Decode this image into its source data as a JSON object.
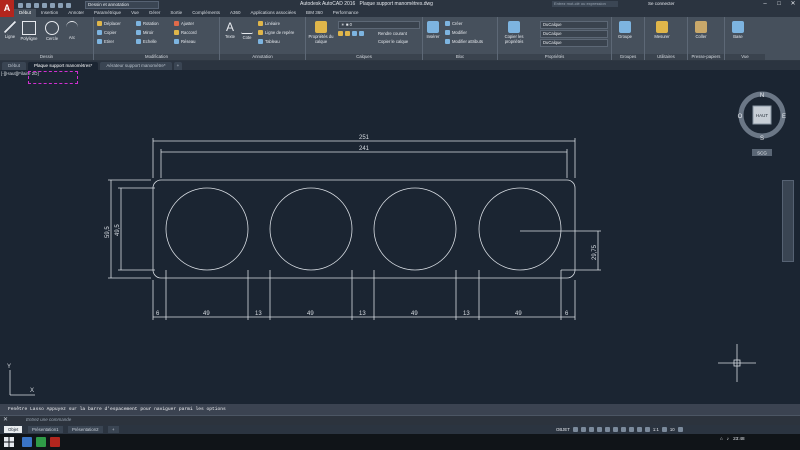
{
  "titlebar": {
    "app_name": "Autodesk AutoCAD 2016",
    "file_name": "Plaque support manomètres.dwg",
    "workspace": "Dessin et annotation",
    "search_placeholder": "Entrez mot-clé ou expression",
    "signin": "Se connecter"
  },
  "ribbon_tabs": [
    "Début",
    "Insertion",
    "Annoter",
    "Paramétrique",
    "Vue",
    "Gérer",
    "Sortie",
    "Compléments",
    "A360",
    "Applications associées",
    "BIM 360",
    "Performance"
  ],
  "active_tab": "Début",
  "ribbon": {
    "dessin": {
      "title": "Dessin",
      "items": [
        "Ligne",
        "Polyligne",
        "Cercle",
        "Arc"
      ]
    },
    "modification": {
      "title": "Modification",
      "items": [
        "Déplacer",
        "Rotation",
        "Ajuster",
        "Copier",
        "Miroir",
        "Raccord",
        "Etirer",
        "Echelle",
        "Réseau"
      ]
    },
    "annotation": {
      "title": "Annotation",
      "items": [
        "Texte",
        "Cote",
        "Linéaire",
        "Ligne de repère",
        "Tableau"
      ]
    },
    "calques": {
      "title": "Calques",
      "items": [
        "Propriétés du calque",
        "Rendre courant",
        "Copier le calque"
      ]
    },
    "bloc": {
      "title": "Bloc",
      "items": [
        "Insérer",
        "Créer",
        "Modifier",
        "Modifier attributs"
      ]
    },
    "proprietes": {
      "title": "Propriétés",
      "items": [
        "Copier les propriétés"
      ],
      "values": [
        "DuCalque",
        "DuCalque",
        "DuCalque"
      ]
    },
    "groupes": {
      "title": "Groupes",
      "items": [
        "Groupe"
      ]
    },
    "utilitaires": {
      "title": "Utilitaires",
      "items": [
        "Mesurer"
      ]
    },
    "presse_papiers": {
      "title": "Presse-papiers",
      "items": [
        "Coller"
      ]
    },
    "vue": {
      "title": "Vue",
      "items": [
        "Base"
      ]
    }
  },
  "doc_tabs": [
    "Début",
    "Plaque support manomètres*",
    "Aérateur support manomètre*"
  ],
  "active_doc_tab": "Plaque support manomètres*",
  "viewport_label": "[-][Haut][Filaire 2D]",
  "viewcube": {
    "top": "HAUT",
    "north": "N",
    "south": "S",
    "east": "E",
    "west": "O",
    "wcs": "SCG"
  },
  "drawing": {
    "dimensions": {
      "overall_width": "251",
      "inner_width": "241",
      "height_outer": "59,5",
      "height_inner": "49,5",
      "radius": "29,75",
      "segments": [
        "6",
        "49",
        "13",
        "49",
        "13",
        "49",
        "13",
        "49",
        "6"
      ]
    },
    "ucs": {
      "x_label": "X",
      "y_label": "Y"
    }
  },
  "command": {
    "history": "Fenêtre Lasso Appuyez sur la barre d'espacement pour naviguer parmi les options",
    "placeholder": "Entrez une commande"
  },
  "layout_tabs": [
    "Objet",
    "Présentation1",
    "Présentation2"
  ],
  "active_layout_tab": "Objet",
  "status": {
    "model": "OBJET",
    "scale": "1:1",
    "zoom_value": "10"
  },
  "taskbar": {
    "time": "23:48"
  },
  "colors": {
    "canvas": "#1b2532",
    "ribbon": "#46505c",
    "accent": "#b3261e"
  }
}
